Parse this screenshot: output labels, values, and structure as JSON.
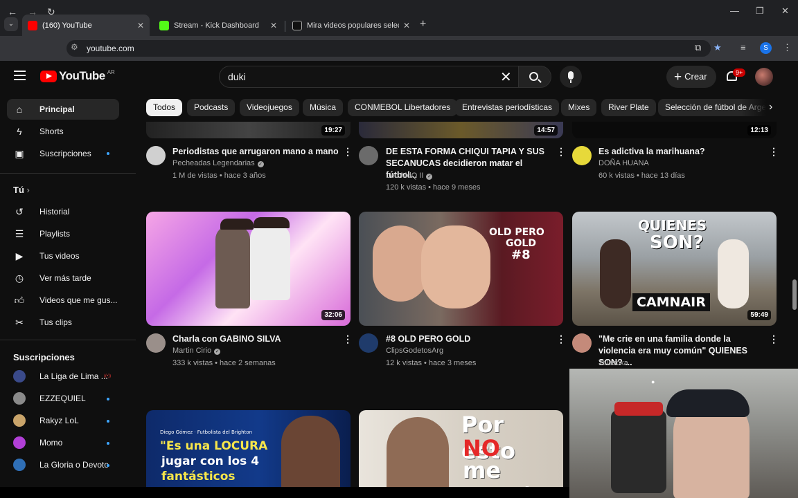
{
  "browser": {
    "tabs": [
      {
        "title": "(160) YouTube",
        "favicon_color": "#ff0000"
      },
      {
        "title": "Stream - Kick Dashboard",
        "favicon_color": "#53fc18"
      },
      {
        "title": "Mira videos populares seleccio",
        "favicon_color": "#111111"
      }
    ],
    "url": "youtube.com",
    "profile_initial": "S"
  },
  "header": {
    "logo_text": "YouTube",
    "country_code": "AR",
    "search_value": "duki",
    "create_label": "Crear",
    "notifications_badge": "9+"
  },
  "chips": [
    "Todos",
    "Podcasts",
    "Videojuegos",
    "Música",
    "CONMEBOL Libertadores",
    "Entrevistas periodísticas",
    "Mixes",
    "River Plate",
    "Selección de fútbol de Argen"
  ],
  "sidebar": {
    "main": [
      {
        "label": "Principal",
        "icon": "home-icon"
      },
      {
        "label": "Shorts",
        "icon": "shorts-icon"
      },
      {
        "label": "Suscripciones",
        "icon": "subscriptions-icon"
      }
    ],
    "you_header": "Tú",
    "you": [
      {
        "label": "Historial",
        "icon": "history-icon"
      },
      {
        "label": "Playlists",
        "icon": "playlists-icon"
      },
      {
        "label": "Tus videos",
        "icon": "your-videos-icon"
      },
      {
        "label": "Ver más tarde",
        "icon": "watch-later-icon"
      },
      {
        "label": "Videos que me gus...",
        "icon": "like-icon"
      },
      {
        "label": "Tus clips",
        "icon": "clips-icon"
      }
    ],
    "subs_header": "Suscripciones",
    "subscriptions": [
      {
        "label": "La Liga de Lima ...",
        "color": "#3a4a8a",
        "live": true
      },
      {
        "label": "EZZEQUIEL",
        "color": "#8a8a8a",
        "live": false
      },
      {
        "label": "Rakyz LoL",
        "color": "#c9a46a",
        "live": false
      },
      {
        "label": "Momo",
        "color": "#b13fd6",
        "live": false
      },
      {
        "label": "La Gloria o Devoto",
        "color": "#2f6fb6",
        "live": false
      }
    ]
  },
  "videos_row1": [
    {
      "duration": "19:27",
      "title": "Periodistas que arrugaron mano a mano",
      "channel": "Pecheadas Legendarias",
      "verified": true,
      "meta": "1 M de vistas • hace 3 años",
      "avatar_color": "#d0d0d0"
    },
    {
      "duration": "14:57",
      "title": "DE ESTA FORMA CHIQUI TAPIA Y SUS SECANUCAS decidieron matar el fútbol...",
      "channel": "Leo MdQ II",
      "verified": true,
      "meta": "120 k vistas • hace 9 meses",
      "avatar_color": "#6b6b6b"
    },
    {
      "duration": "12:13",
      "title": "Es adictiva la marihuana?",
      "channel": "DOÑA HUANA",
      "verified": false,
      "meta": "60 k vistas • hace 13 días",
      "avatar_color": "#e7d93a"
    }
  ],
  "videos_row2": [
    {
      "duration": "32:06",
      "title": "Charla con GABINO SILVA",
      "channel": "Martin Cirio",
      "verified": true,
      "meta": "333 k vistas • hace 2 semanas",
      "avatar_color": "#9a8f8a"
    },
    {
      "duration": "",
      "title": "#8 OLD PERO GOLD",
      "channel": "ClipsGodetosArg",
      "verified": false,
      "meta": "12 k vistas • hace 3 meses",
      "avatar_color": "#1f3b6b",
      "thumb_text": [
        "OLD PERO",
        "GOLD",
        "#8"
      ]
    },
    {
      "duration": "59:49",
      "title": "\"Me crie en una familia donde la violencia era muy común\" QUIENES SON? ...",
      "channel": "Talascka",
      "verified": false,
      "meta": "",
      "avatar_color": "#c48a7a",
      "thumb_text": [
        "QUIENES",
        "SON?",
        "CAMNAIR"
      ]
    }
  ],
  "videos_row3": [
    {
      "thumb_text": [
        "Diego Gómez · Futbolista del Brighton",
        "\"Es una LOCURA",
        "jugar con los 4",
        "fantásticos"
      ]
    },
    {
      "thumb_text": [
        "Por esto",
        "NO",
        "me rendí"
      ]
    }
  ]
}
